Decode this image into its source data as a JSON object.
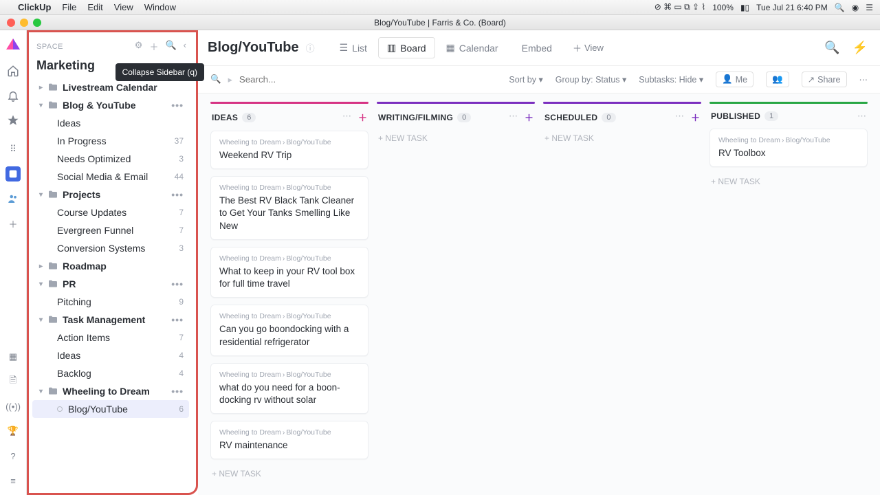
{
  "menubar": {
    "app": "ClickUp",
    "items": [
      "File",
      "Edit",
      "View",
      "Window"
    ],
    "clock": "Tue Jul 21  6:40 PM",
    "battery": "100%"
  },
  "window_title": "Blog/YouTube | Farris & Co. (Board)",
  "sidebar": {
    "space_label": "SPACE",
    "space_title": "Marketing",
    "tooltip": "Collapse Sidebar (q)",
    "tree": [
      {
        "type": "folder",
        "label": "Livestream Calendar",
        "open": false
      },
      {
        "type": "folder",
        "label": "Blog & YouTube",
        "open": true,
        "children": [
          {
            "label": "Ideas",
            "count": ""
          },
          {
            "label": "In Progress",
            "count": "37"
          },
          {
            "label": "Needs Optimized",
            "count": "3"
          },
          {
            "label": "Social Media & Email",
            "count": "44"
          }
        ]
      },
      {
        "type": "folder",
        "label": "Projects",
        "open": true,
        "children": [
          {
            "label": "Course Updates",
            "count": "7"
          },
          {
            "label": "Evergreen Funnel",
            "count": "7"
          },
          {
            "label": "Conversion Systems",
            "count": "3"
          }
        ]
      },
      {
        "type": "folder",
        "label": "Roadmap",
        "open": false
      },
      {
        "type": "folder",
        "label": "PR",
        "open": true,
        "children": [
          {
            "label": "Pitching",
            "count": "9"
          }
        ]
      },
      {
        "type": "folder",
        "label": "Task Management",
        "open": true,
        "children": [
          {
            "label": "Action Items",
            "count": "7"
          },
          {
            "label": "Ideas",
            "count": "4"
          },
          {
            "label": "Backlog",
            "count": "4"
          }
        ]
      },
      {
        "type": "folder",
        "label": "Wheeling to Dream",
        "open": true,
        "children": [
          {
            "label": "Blog/YouTube",
            "count": "6",
            "selected": true,
            "list": true
          }
        ]
      }
    ]
  },
  "page": {
    "title": "Blog/YouTube",
    "views": [
      {
        "label": "List",
        "icon": "list"
      },
      {
        "label": "Board",
        "icon": "board",
        "active": true
      },
      {
        "label": "Calendar",
        "icon": "calendar"
      },
      {
        "label": "Embed",
        "icon": "embed"
      }
    ],
    "add_view": "View"
  },
  "toolbar": {
    "search_placeholder": "Search...",
    "sort": "Sort by",
    "group": "Group by: Status",
    "subtasks": "Subtasks: Hide",
    "me": "Me",
    "share": "Share"
  },
  "board": {
    "new_task": "+ NEW TASK",
    "crumb_parent": "Wheeling to Dream",
    "crumb_child": "Blog/YouTube",
    "columns": [
      {
        "title": "IDEAS",
        "count": "6",
        "color": "#d63384",
        "plus": "#d63384",
        "cards": [
          {
            "title": "Weekend RV Trip"
          },
          {
            "title": "The Best RV Black Tank Cleaner to Get Your Tanks Smelling Like New"
          },
          {
            "title": "What to keep in your RV tool box for full time travel"
          },
          {
            "title": "Can you go boondocking with a residential refrigerator"
          },
          {
            "title": "what do you need for a boon-docking rv without solar"
          },
          {
            "title": "RV maintenance"
          }
        ]
      },
      {
        "title": "WRITING/FILMING",
        "count": "0",
        "color": "#7b2fbf",
        "plus": "#7b2fbf",
        "cards": []
      },
      {
        "title": "SCHEDULED",
        "count": "0",
        "color": "#7b2fbf",
        "plus": "#7b2fbf",
        "cards": []
      },
      {
        "title": "PUBLISHED",
        "count": "1",
        "color": "#28a745",
        "plus": "",
        "cards": [
          {
            "title": "RV Toolbox"
          }
        ]
      }
    ]
  }
}
